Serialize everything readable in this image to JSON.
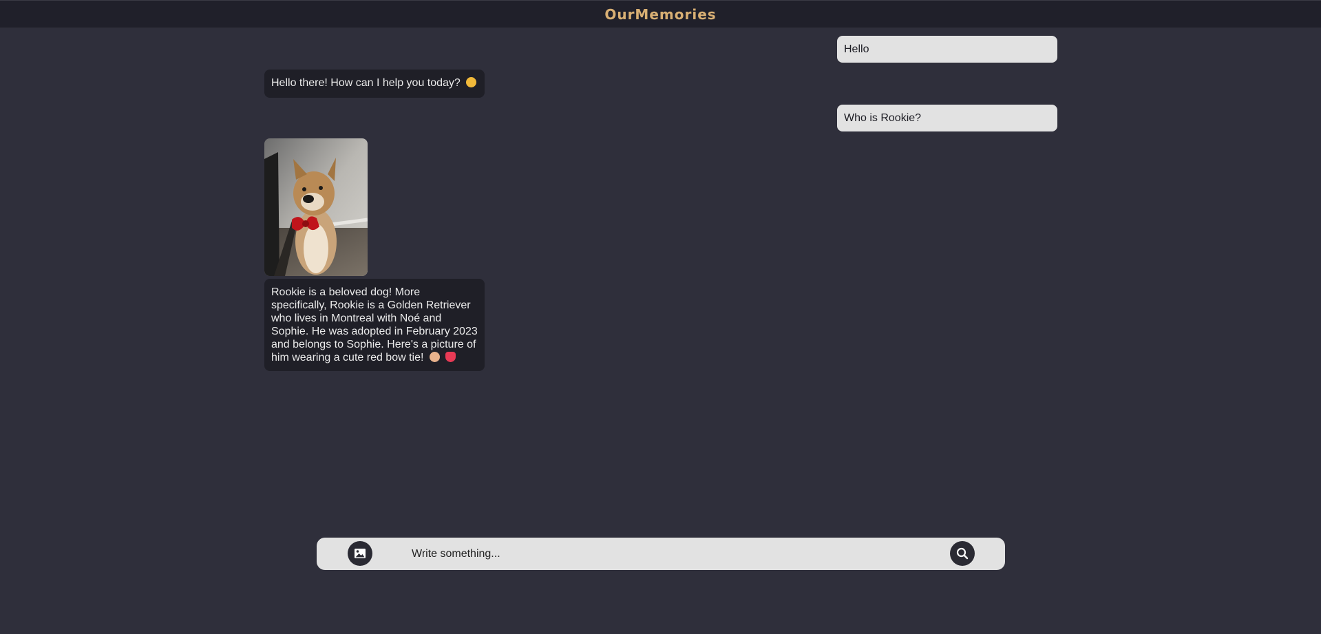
{
  "header": {
    "title": "OurMemories"
  },
  "messages": [
    {
      "role": "user",
      "text": "Hello"
    },
    {
      "role": "assistant",
      "text": "Hello there! How can I help you today?",
      "emoji": "smiling-face"
    },
    {
      "role": "user",
      "text": "Who is Rookie?"
    },
    {
      "role": "assistant",
      "image": "dog-with-red-bow-tie-photo",
      "text": "Rookie is a beloved dog! More specifically, Rookie is a Golden Retriever who lives in Montreal with Noé and Sophie. He was adopted in February 2023 and belongs to Sophie. Here's a picture of him wearing a cute red bow tie!",
      "emojis": [
        "dog-face",
        "red-heart"
      ]
    }
  ],
  "composer": {
    "placeholder": "Write something...",
    "image_button_icon": "image-icon",
    "send_button_icon": "search-icon"
  },
  "colors": {
    "background": "#2f2f3b",
    "header": "#20202a",
    "brand": "#d9b074",
    "user_bubble": "#e2e2e2",
    "bot_bubble": "#1f1f27"
  }
}
